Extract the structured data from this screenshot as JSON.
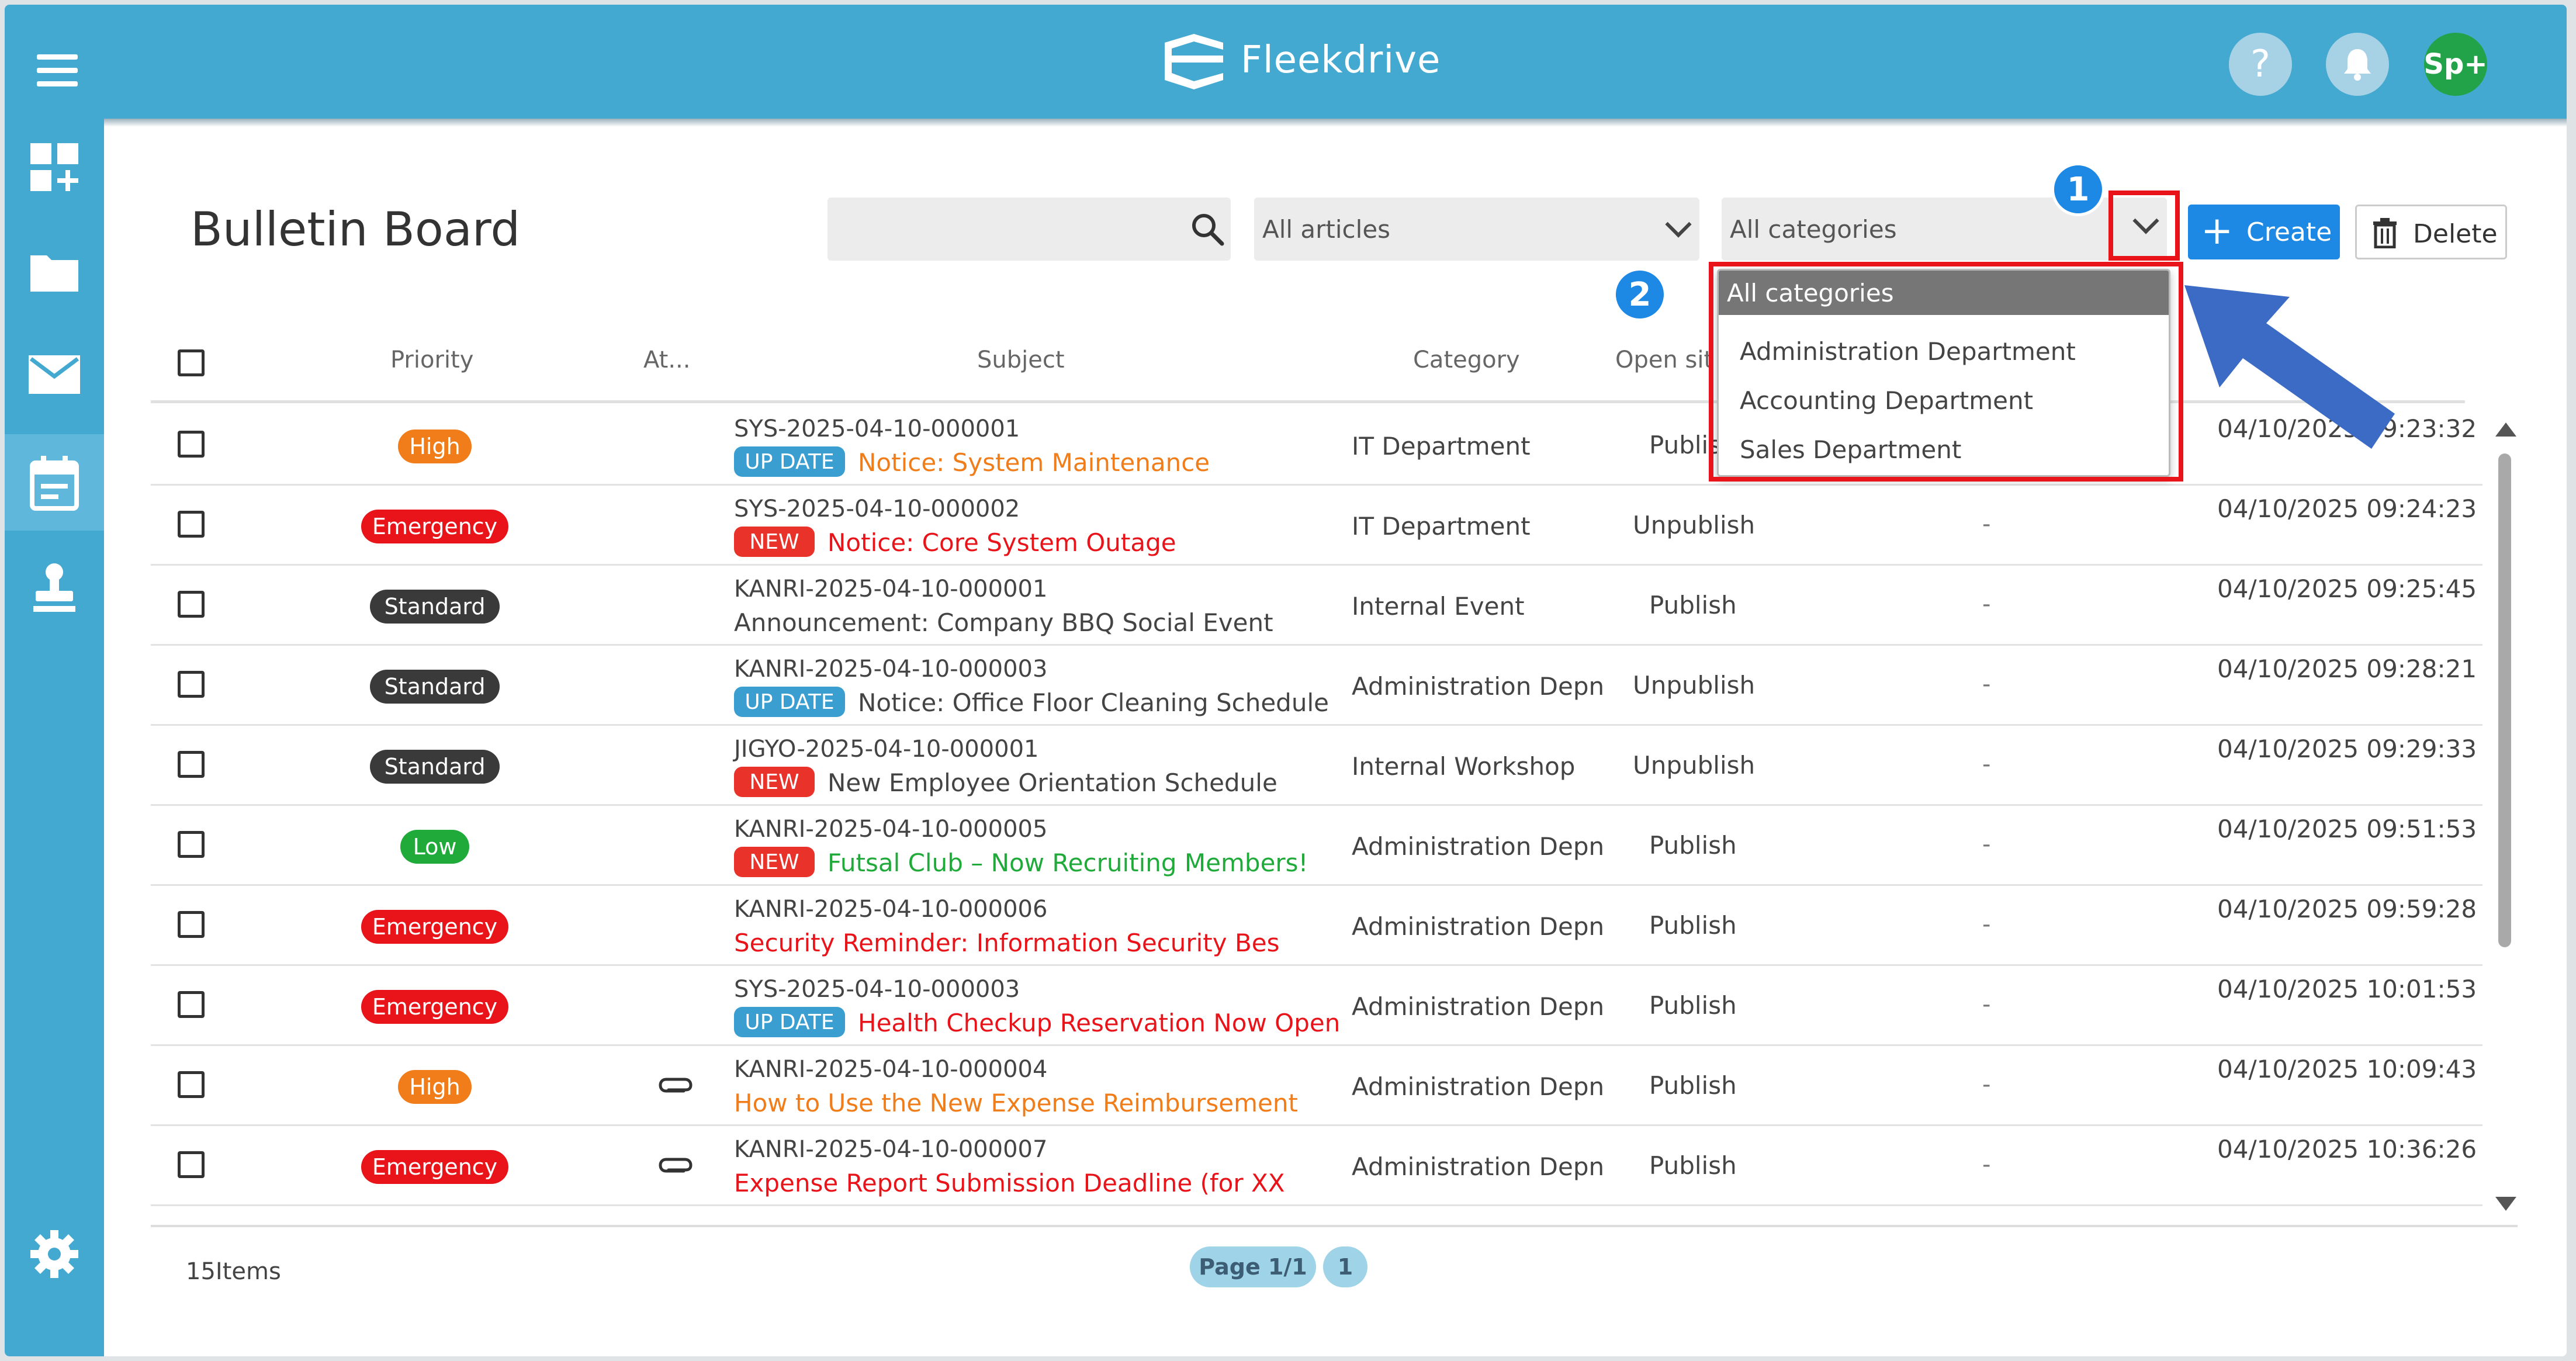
{
  "app": {
    "brand": "Fleekdrive"
  },
  "header": {
    "help_label": "?",
    "user_initials": "Sp+"
  },
  "page": {
    "title": "Bulletin Board"
  },
  "filters": {
    "search_placeholder": "",
    "articles_select": "All articles",
    "categories_select": "All categories",
    "create_label": "Create",
    "delete_label": "Delete"
  },
  "annotations": {
    "step1": "1",
    "step2": "2"
  },
  "dropdown": {
    "header": "All categories",
    "options": [
      "Administration Department",
      "Accounting Department",
      "Sales Department"
    ]
  },
  "table": {
    "columns": {
      "priority": "Priority",
      "attachment": "At...",
      "subject": "Subject",
      "category": "Category",
      "open_site": "Open sit"
    },
    "rows": [
      {
        "priority": "High",
        "priority_color": "#f07d19",
        "id": "SYS-2025-04-10-000001",
        "tag": "UP DATE",
        "tag_color": "#3a9fd0",
        "subject": "Notice: System Maintenance",
        "subject_color": "#f07d19",
        "category": "IT Department",
        "open_site": "Publish",
        "dash": "-",
        "date": "04/10/2025 09:23:32",
        "attachment": false
      },
      {
        "priority": "Emergency",
        "priority_color": "#e8141a",
        "id": "SYS-2025-04-10-000002",
        "tag": "NEW",
        "tag_color": "#e8322a",
        "subject": "Notice: Core System Outage",
        "subject_color": "#e8141a",
        "category": "IT Department",
        "open_site": "Unpublish",
        "dash": "-",
        "date": "04/10/2025 09:24:23",
        "attachment": false
      },
      {
        "priority": "Standard",
        "priority_color": "#3a3a3a",
        "id": "KANRI-2025-04-10-000001",
        "tag": "",
        "tag_color": "",
        "subject": "Announcement: Company BBQ Social Event",
        "subject_color": "#444444",
        "category": "Internal Event",
        "open_site": "Publish",
        "dash": "-",
        "date": "04/10/2025 09:25:45",
        "attachment": false
      },
      {
        "priority": "Standard",
        "priority_color": "#3a3a3a",
        "id": "KANRI-2025-04-10-000003",
        "tag": "UP DATE",
        "tag_color": "#3a9fd0",
        "subject": "Notice: Office Floor Cleaning Schedule",
        "subject_color": "#444444",
        "category": "Administration Depn",
        "open_site": "Unpublish",
        "dash": "-",
        "date": "04/10/2025 09:28:21",
        "attachment": false
      },
      {
        "priority": "Standard",
        "priority_color": "#3a3a3a",
        "id": "JIGYO-2025-04-10-000001",
        "tag": "NEW",
        "tag_color": "#e8322a",
        "subject": "New Employee Orientation Schedule",
        "subject_color": "#444444",
        "category": "Internal Workshop",
        "open_site": "Unpublish",
        "dash": "-",
        "date": "04/10/2025 09:29:33",
        "attachment": false
      },
      {
        "priority": "Low",
        "priority_color": "#1faa3a",
        "id": "KANRI-2025-04-10-000005",
        "tag": "NEW",
        "tag_color": "#e8322a",
        "subject": "Futsal Club – Now Recruiting Members!",
        "subject_color": "#1faa3a",
        "category": "Administration Depn",
        "open_site": "Publish",
        "dash": "-",
        "date": "04/10/2025 09:51:53",
        "attachment": false
      },
      {
        "priority": "Emergency",
        "priority_color": "#e8141a",
        "id": "KANRI-2025-04-10-000006",
        "tag": "",
        "tag_color": "",
        "subject": "Security Reminder: Information Security Bes",
        "subject_color": "#e8141a",
        "category": "Administration Depn",
        "open_site": "Publish",
        "dash": "-",
        "date": "04/10/2025 09:59:28",
        "attachment": false
      },
      {
        "priority": "Emergency",
        "priority_color": "#e8141a",
        "id": "SYS-2025-04-10-000003",
        "tag": "UP DATE",
        "tag_color": "#3a9fd0",
        "subject": "Health Checkup Reservation Now Open",
        "subject_color": "#e8141a",
        "category": "Administration Depn",
        "open_site": "Publish",
        "dash": "-",
        "date": "04/10/2025 10:01:53",
        "attachment": false
      },
      {
        "priority": "High",
        "priority_color": "#f07d19",
        "id": "KANRI-2025-04-10-000004",
        "tag": "",
        "tag_color": "",
        "subject": "How to Use the New Expense Reimbursement",
        "subject_color": "#f07d19",
        "category": "Administration Depn",
        "open_site": "Publish",
        "dash": "-",
        "date": "04/10/2025 10:09:43",
        "attachment": true
      },
      {
        "priority": "Emergency",
        "priority_color": "#e8141a",
        "id": "KANRI-2025-04-10-000007",
        "tag": "",
        "tag_color": "",
        "subject": "Expense Report Submission Deadline (for XX",
        "subject_color": "#e8141a",
        "category": "Administration Depn",
        "open_site": "Publish",
        "dash": "-",
        "date": "04/10/2025 10:36:26",
        "attachment": true
      }
    ]
  },
  "footer": {
    "items_count": "15Items",
    "page_label": "Page 1/1",
    "page_number": "1"
  },
  "colors": {
    "topbar": "#44a9d1",
    "primary": "#1e88e5",
    "highlight": "#e8141a"
  }
}
